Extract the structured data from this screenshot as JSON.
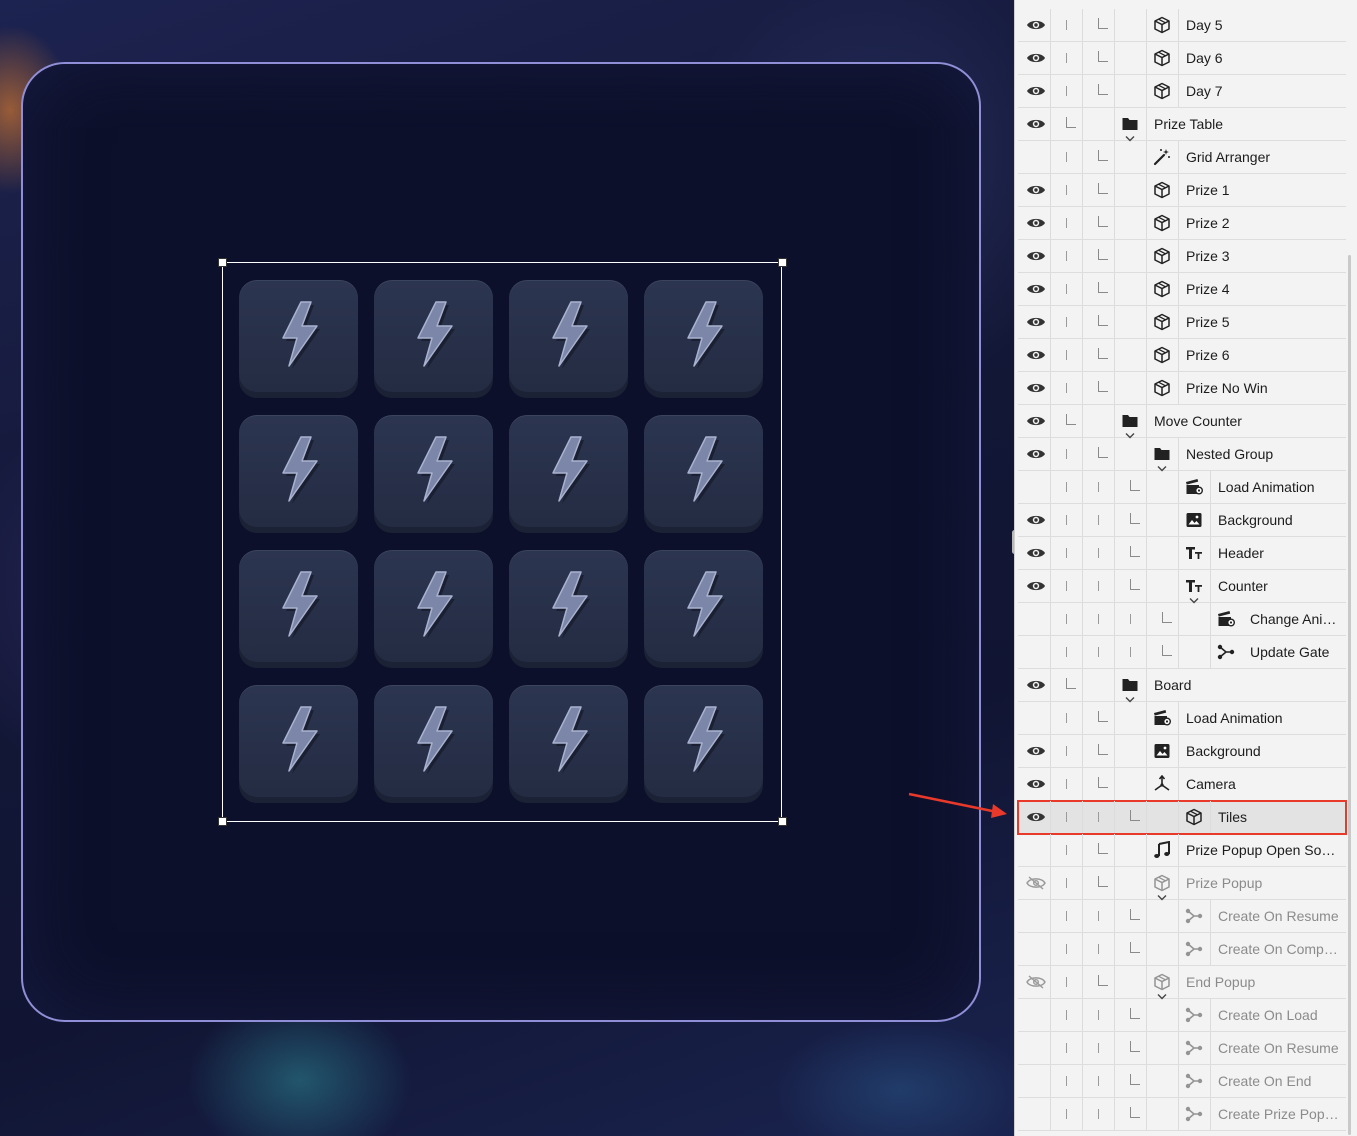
{
  "canvas": {
    "tile_rows": 4,
    "tile_cols": 4,
    "tile_icon": "lightning-icon"
  },
  "layers": [
    {
      "label": "Day 5",
      "icon": "cube-icon",
      "depth": 2,
      "visible": true
    },
    {
      "label": "Day 6",
      "icon": "cube-icon",
      "depth": 2,
      "visible": true
    },
    {
      "label": "Day 7",
      "icon": "cube-icon",
      "depth": 2,
      "visible": true
    },
    {
      "label": "Prize Table",
      "icon": "folder-icon",
      "depth": 1,
      "visible": true,
      "expanded": true
    },
    {
      "label": "Grid Arranger",
      "icon": "magic-wand-icon",
      "depth": 2,
      "visible": null
    },
    {
      "label": "Prize 1",
      "icon": "cube-icon",
      "depth": 2,
      "visible": true
    },
    {
      "label": "Prize 2",
      "icon": "cube-icon",
      "depth": 2,
      "visible": true
    },
    {
      "label": "Prize 3",
      "icon": "cube-icon",
      "depth": 2,
      "visible": true
    },
    {
      "label": "Prize 4",
      "icon": "cube-icon",
      "depth": 2,
      "visible": true
    },
    {
      "label": "Prize 5",
      "icon": "cube-icon",
      "depth": 2,
      "visible": true
    },
    {
      "label": "Prize 6",
      "icon": "cube-icon",
      "depth": 2,
      "visible": true
    },
    {
      "label": "Prize No Win",
      "icon": "cube-icon",
      "depth": 2,
      "visible": true
    },
    {
      "label": "Move Counter",
      "icon": "folder-icon",
      "depth": 1,
      "visible": true,
      "expanded": true
    },
    {
      "label": "Nested Group",
      "icon": "folder-icon",
      "depth": 2,
      "visible": true,
      "expanded": true
    },
    {
      "label": "Load Animation",
      "icon": "clapper-icon",
      "depth": 3,
      "visible": null
    },
    {
      "label": "Background",
      "icon": "image-icon",
      "depth": 3,
      "visible": true
    },
    {
      "label": "Header",
      "icon": "text-icon",
      "depth": 3,
      "visible": true
    },
    {
      "label": "Counter",
      "icon": "text-icon",
      "depth": 3,
      "visible": true,
      "expanded": true
    },
    {
      "label": "Change Animation",
      "icon": "clapper-icon",
      "depth": 4,
      "visible": null
    },
    {
      "label": "Update Gate",
      "icon": "gate-icon",
      "depth": 4,
      "visible": null
    },
    {
      "label": "Board",
      "icon": "folder-icon",
      "depth": 1,
      "visible": true,
      "expanded": true
    },
    {
      "label": "Load Animation",
      "icon": "clapper-icon",
      "depth": 2,
      "visible": null
    },
    {
      "label": "Background",
      "icon": "image-icon",
      "depth": 2,
      "visible": true
    },
    {
      "label": "Camera",
      "icon": "camera-axes-icon",
      "depth": 2,
      "visible": true
    },
    {
      "label": "Tiles",
      "icon": "cube-icon",
      "depth": 3,
      "visible": true,
      "selected": true
    },
    {
      "label": "Prize Popup Open Sound",
      "icon": "music-note-icon",
      "depth": 2,
      "visible": null
    },
    {
      "label": "Prize Popup",
      "icon": "cube-icon",
      "depth": 2,
      "visible": false,
      "expanded": true,
      "dim": true
    },
    {
      "label": "Create On Resume",
      "icon": "gate-icon",
      "depth": 3,
      "visible": null,
      "dim": true
    },
    {
      "label": "Create On Completed",
      "icon": "gate-icon",
      "depth": 3,
      "visible": null,
      "dim": true
    },
    {
      "label": "End Popup",
      "icon": "cube-icon",
      "depth": 2,
      "visible": false,
      "expanded": true,
      "dim": true
    },
    {
      "label": "Create On Load",
      "icon": "gate-icon",
      "depth": 3,
      "visible": null,
      "dim": true
    },
    {
      "label": "Create On Resume",
      "icon": "gate-icon",
      "depth": 3,
      "visible": null,
      "dim": true
    },
    {
      "label": "Create On End",
      "icon": "gate-icon",
      "depth": 3,
      "visible": null,
      "dim": true
    },
    {
      "label": "Create Prize Popup Cl...",
      "icon": "gate-icon",
      "depth": 3,
      "visible": null,
      "dim": true
    }
  ],
  "colors": {
    "selection_outline": "#e8392b",
    "annotation_arrow": "#e8392b",
    "frame_border": "#8f8ed6"
  }
}
